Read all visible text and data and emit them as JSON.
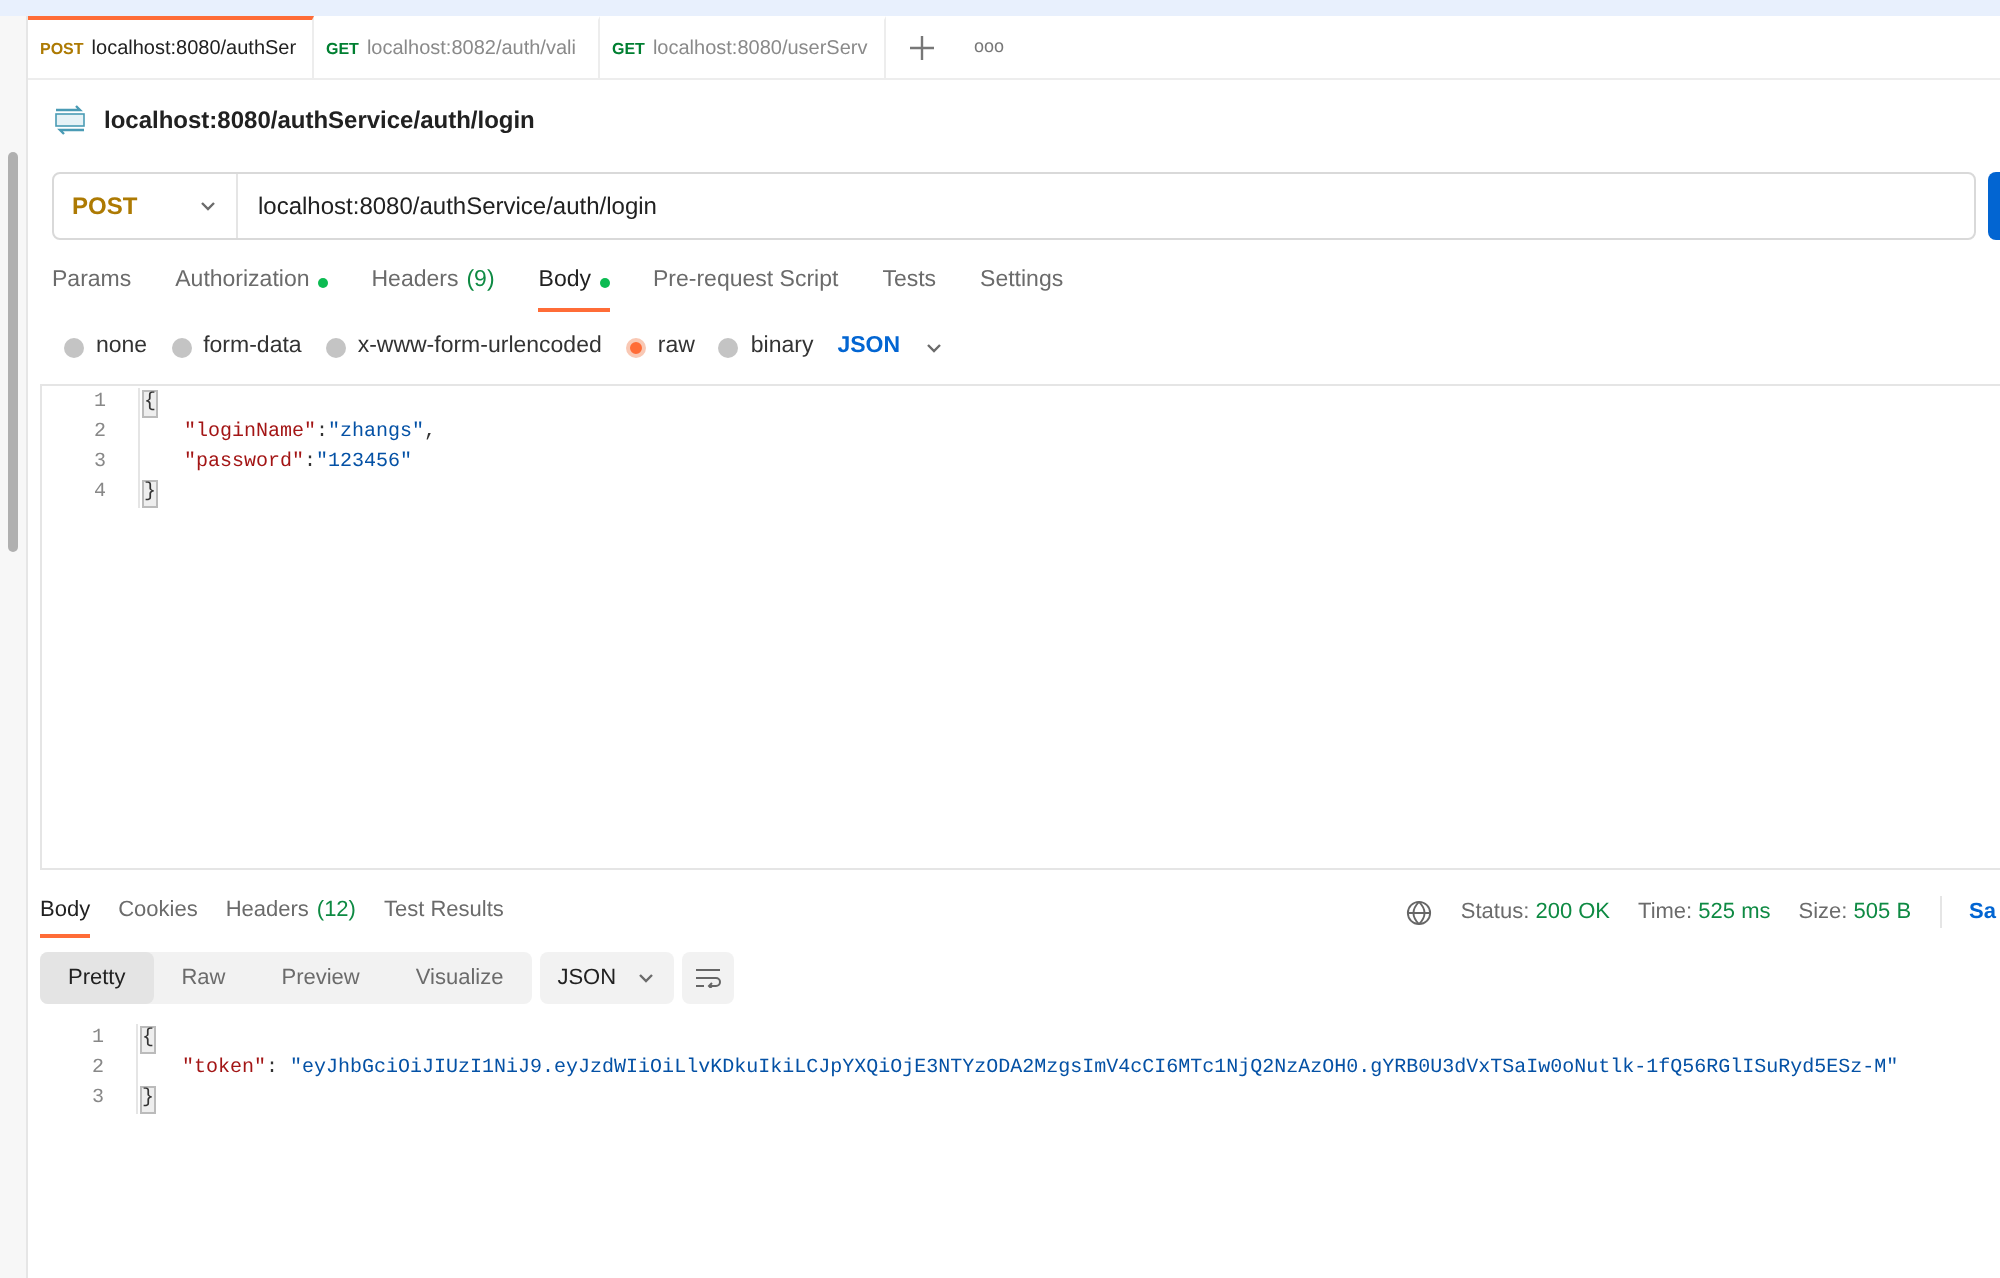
{
  "tabs": [
    {
      "method": "POST",
      "label": "localhost:8080/authSer",
      "selected": true
    },
    {
      "method": "GET",
      "label": "localhost:8082/auth/vali",
      "selected": false
    },
    {
      "method": "GET",
      "label": "localhost:8080/userServ",
      "selected": false
    }
  ],
  "tab_more": "ooo",
  "request": {
    "title": "localhost:8080/authService/auth/login",
    "method": "POST",
    "url": "localhost:8080/authService/auth/login"
  },
  "request_tabs": [
    {
      "label": "Params",
      "selected": false
    },
    {
      "label": "Authorization",
      "dot": true,
      "selected": false
    },
    {
      "label": "Headers",
      "count": "(9)",
      "selected": false
    },
    {
      "label": "Body",
      "dot": true,
      "selected": true
    },
    {
      "label": "Pre-request Script",
      "selected": false
    },
    {
      "label": "Tests",
      "selected": false
    },
    {
      "label": "Settings",
      "selected": false
    }
  ],
  "body_types": [
    {
      "label": "none",
      "selected": false
    },
    {
      "label": "form-data",
      "selected": false
    },
    {
      "label": "x-www-form-urlencoded",
      "selected": false
    },
    {
      "label": "raw",
      "selected": true
    },
    {
      "label": "binary",
      "selected": false
    }
  ],
  "body_format": "JSON",
  "request_body": [
    {
      "number": "1",
      "tokens": [
        {
          "kind": "brace",
          "text": "{"
        }
      ]
    },
    {
      "number": "2",
      "tokens": [
        {
          "kind": "key",
          "text": "\"loginName\""
        },
        {
          "kind": "punct",
          "text": ":"
        },
        {
          "kind": "string",
          "text": "\"zhangs\""
        },
        {
          "kind": "punct",
          "text": ","
        }
      ]
    },
    {
      "number": "3",
      "tokens": [
        {
          "kind": "key",
          "text": "\"password\""
        },
        {
          "kind": "punct",
          "text": ":"
        },
        {
          "kind": "string",
          "text": "\"123456\""
        }
      ]
    },
    {
      "number": "4",
      "tokens": [
        {
          "kind": "brace",
          "text": "}"
        }
      ]
    }
  ],
  "response_tabs": [
    {
      "label": "Body",
      "selected": true
    },
    {
      "label": "Cookies",
      "selected": false
    },
    {
      "label": "Headers",
      "count": "(12)",
      "selected": false
    },
    {
      "label": "Test Results",
      "selected": false
    }
  ],
  "response_meta": [
    {
      "label": "Status:",
      "value": "200 OK"
    },
    {
      "label": "Time:",
      "value": "525 ms"
    },
    {
      "label": "Size:",
      "value": "505 B"
    }
  ],
  "save_label": "Sa",
  "view_modes": [
    {
      "label": "Pretty",
      "selected": true
    },
    {
      "label": "Raw",
      "selected": false
    },
    {
      "label": "Preview",
      "selected": false
    },
    {
      "label": "Visualize",
      "selected": false
    }
  ],
  "response_format": "JSON",
  "response_body": [
    {
      "number": "1",
      "tokens": [
        {
          "kind": "brace",
          "text": "{"
        }
      ]
    },
    {
      "number": "2",
      "tokens": [
        {
          "kind": "key",
          "text": "\"token\""
        },
        {
          "kind": "punct",
          "text": ": "
        },
        {
          "kind": "string",
          "text": "\"eyJhbGciOiJIUzI1NiJ9.eyJzdWIiOiLlvKDkuIkiLCJpYXQiOjE3NTYzODA2MzgsImV4cCI6MTc1NjQ2NzAzOH0.gYRB0U3dVxTSaIw0oNutlk-1fQ56RGlISuRyd5ESz-M\""
        }
      ]
    },
    {
      "number": "3",
      "tokens": [
        {
          "kind": "brace",
          "text": "}"
        }
      ]
    }
  ]
}
